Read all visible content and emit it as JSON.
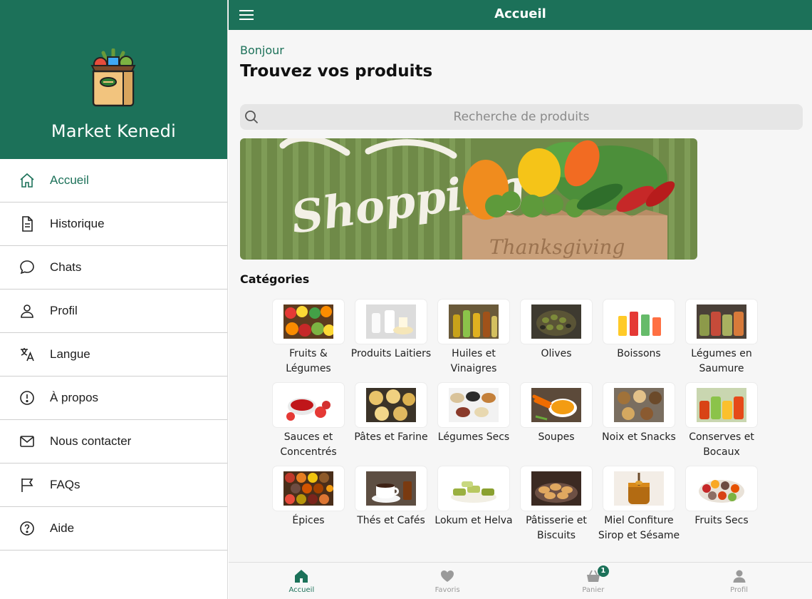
{
  "drawer": {
    "brand": "Market Kenedi",
    "items": [
      {
        "label": "Accueil",
        "icon": "home-icon",
        "active": true
      },
      {
        "label": "Historique",
        "icon": "document-icon"
      },
      {
        "label": "Chats",
        "icon": "chat-icon"
      },
      {
        "label": "Profil",
        "icon": "user-icon"
      },
      {
        "label": "Langue",
        "icon": "translate-icon"
      },
      {
        "label": "À propos",
        "icon": "info-icon"
      },
      {
        "label": "Nous contacter",
        "icon": "mail-icon"
      },
      {
        "label": "FAQs",
        "icon": "flag-icon"
      },
      {
        "label": "Aide",
        "icon": "help-icon"
      }
    ]
  },
  "topbar": {
    "title": "Accueil"
  },
  "home": {
    "greeting": "Bonjour",
    "headline": "Trouvez vos produits",
    "search_placeholder": "Recherche de produits",
    "banner_text": "Shopping",
    "banner_bag_text": "Thanksgiving",
    "categories_title": "Catégories"
  },
  "categories": [
    {
      "label": "Fruits & Légumes"
    },
    {
      "label": "Produits Laitiers"
    },
    {
      "label": "Huiles et Vinaigres"
    },
    {
      "label": "Olives"
    },
    {
      "label": "Boissons"
    },
    {
      "label": "Légumes en Saumure"
    },
    {
      "label": "Sauces et Concentrés"
    },
    {
      "label": "Pâtes et Farine"
    },
    {
      "label": "Légumes Secs"
    },
    {
      "label": "Soupes"
    },
    {
      "label": "Noix et Snacks"
    },
    {
      "label": "Conserves et Bocaux"
    },
    {
      "label": "Épices"
    },
    {
      "label": "Thés et Cafés"
    },
    {
      "label": "Lokum et Helva"
    },
    {
      "label": "Pâtisserie et Biscuits"
    },
    {
      "label": "Miel Confiture Sirop et Sésame"
    },
    {
      "label": "Fruits Secs"
    }
  ],
  "bottom_nav": [
    {
      "label": "Accueil",
      "icon": "home-icon",
      "active": true
    },
    {
      "label": "Favoris",
      "icon": "heart-icon"
    },
    {
      "label": "Panier",
      "icon": "basket-icon",
      "badge": "1"
    },
    {
      "label": "Profil",
      "icon": "user-icon"
    }
  ],
  "colors": {
    "primary": "#1c7159",
    "background": "#f6f6f6",
    "search_bg": "#e6e6e6"
  }
}
